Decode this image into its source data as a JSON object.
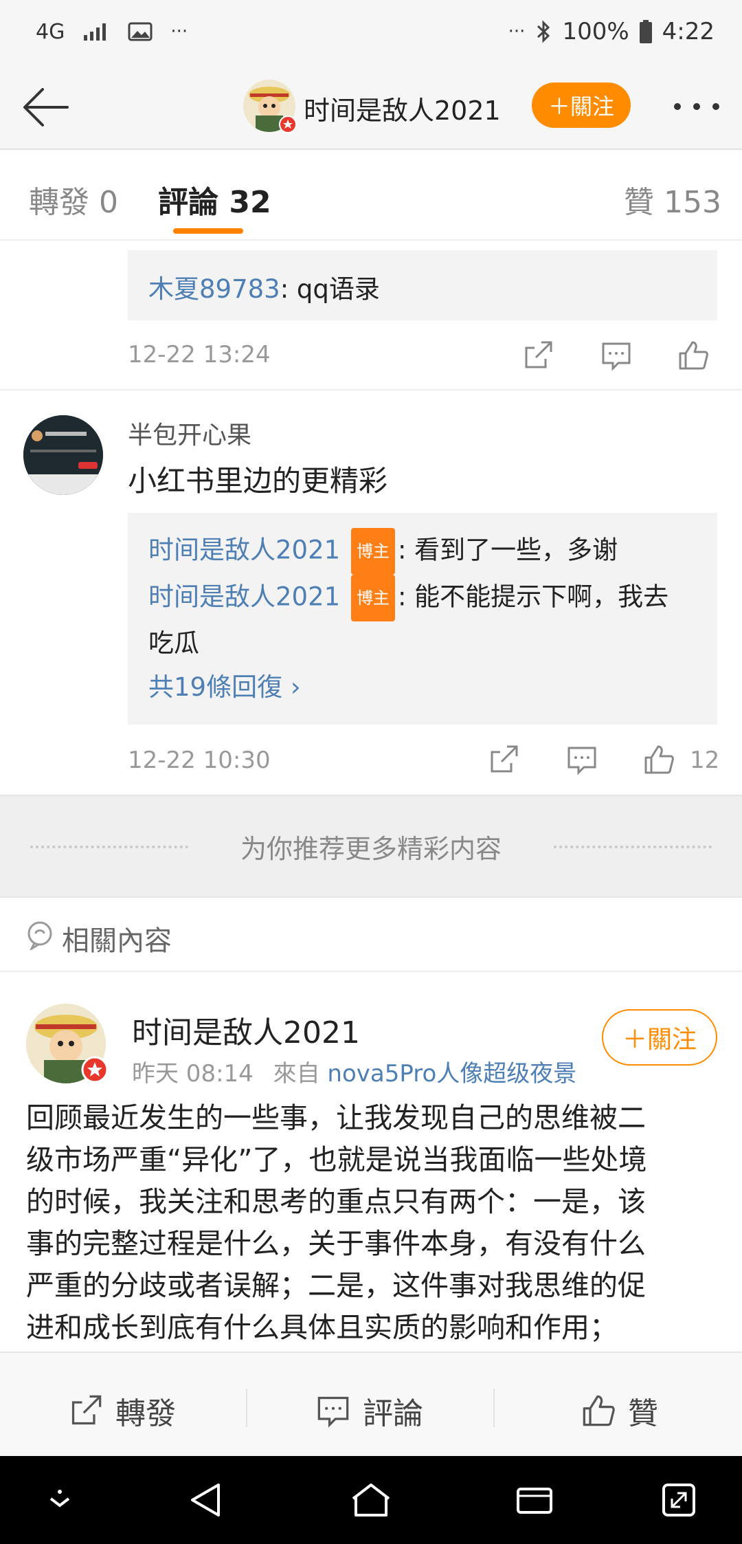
{
  "status_bar": {
    "network": "4G",
    "battery": "100%",
    "time": "4:22",
    "more": "···"
  },
  "nav": {
    "title": "时间是敌人2021",
    "follow": "＋關注",
    "icons": [
      "back-arrow-icon",
      "more-icon"
    ]
  },
  "tabs": {
    "repost": {
      "label": "轉發",
      "count": "0"
    },
    "comments": {
      "label": "評論",
      "count": "32"
    },
    "likes": {
      "label": "贊",
      "count": "153"
    }
  },
  "comment1": {
    "reply_user": "木夏89783",
    "reply_text": ": qq语录",
    "time": "12-22 13:24"
  },
  "comment2": {
    "user": "半包开心果",
    "text": "小红书里边的更精彩",
    "replies": [
      {
        "user": "时间是敌人2021",
        "badge": "博主",
        "text": ": 看到了一些，多谢"
      },
      {
        "user": "时间是敌人2021",
        "badge": "博主",
        "text": ": 能不能提示下啊，我去",
        "text2": "吃瓜"
      }
    ],
    "more_replies": "共19條回復 ›",
    "time": "12-22 10:30",
    "like_count": "12"
  },
  "recommend": {
    "text": "为你推荐更多精彩内容"
  },
  "related": {
    "label": "相關內容"
  },
  "post": {
    "user": "时间是敌人2021",
    "time": "昨天 08:14",
    "source_prefix": "來自",
    "source": "nova5Pro人像超级夜景",
    "follow": "＋關注",
    "lines": [
      "回顾最近发生的一些事，让我发现自己的思维被二",
      "级市场严重“异化”了，也就是说当我面临一些处境",
      "的时候，我关注和思考的重点只有两个：一是，该",
      "事的完整过程是什么，关于事件本身，有没有什么",
      "严重的分歧或者误解；二是，这件事对我思维的促",
      "进和成长到底有什么具体且实质的影响和作用；"
    ]
  },
  "bottom_bar": {
    "repost": "轉發",
    "comment": "評論",
    "like": "贊"
  },
  "colors": {
    "accent": "#ff8c00",
    "link": "#4e7fb4",
    "badge": "#ff7f17"
  }
}
